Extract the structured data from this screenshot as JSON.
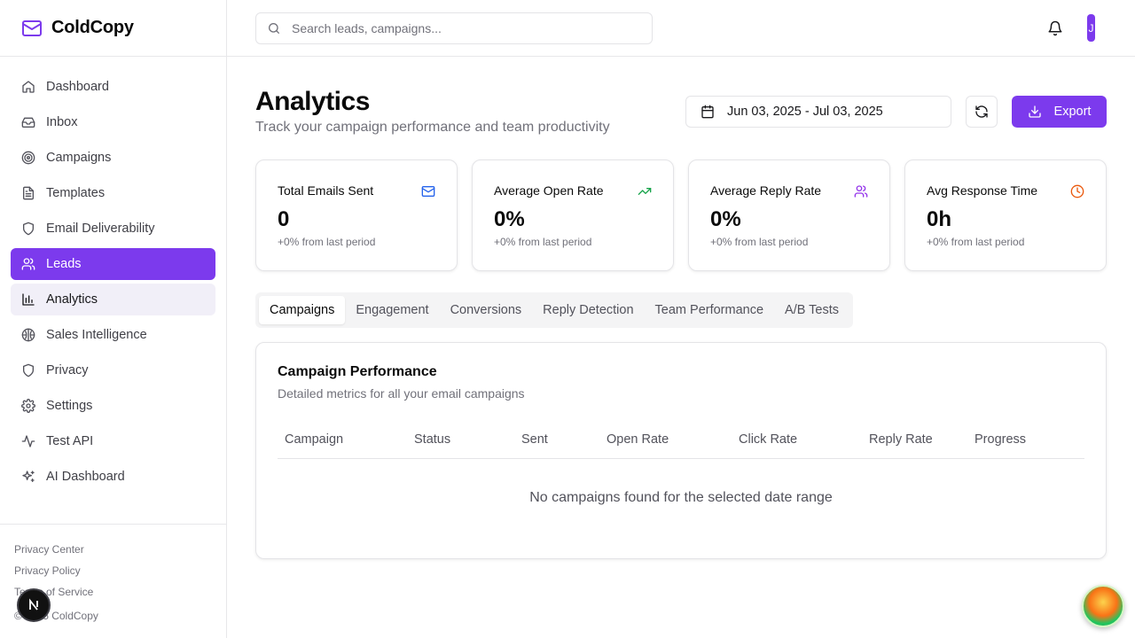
{
  "brand": {
    "name": "ColdCopy"
  },
  "search": {
    "placeholder": "Search leads, campaigns..."
  },
  "nav": {
    "items": [
      {
        "label": "Dashboard"
      },
      {
        "label": "Inbox"
      },
      {
        "label": "Campaigns"
      },
      {
        "label": "Templates"
      },
      {
        "label": "Email Deliverability"
      },
      {
        "label": "Leads"
      },
      {
        "label": "Analytics"
      },
      {
        "label": "Sales Intelligence"
      },
      {
        "label": "Privacy"
      },
      {
        "label": "Settings"
      },
      {
        "label": "Test API"
      },
      {
        "label": "AI Dashboard"
      }
    ]
  },
  "footer": {
    "links": [
      "Privacy Center",
      "Privacy Policy",
      "Terms of Service"
    ],
    "copyright": "© 2025 ColdCopy"
  },
  "user": {
    "initial": "J"
  },
  "page": {
    "title": "Analytics",
    "subtitle": "Track your campaign performance and team productivity",
    "date_range": "Jun 03, 2025 - Jul 03, 2025",
    "export_label": "Export"
  },
  "stats": [
    {
      "title": "Total Emails Sent",
      "value": "0",
      "change": "+0% from last period",
      "icon": "mail-icon",
      "color": "#2563eb"
    },
    {
      "title": "Average Open Rate",
      "value": "0%",
      "change": "+0% from last period",
      "icon": "trending-up-icon",
      "color": "#16a34a"
    },
    {
      "title": "Average Reply Rate",
      "value": "0%",
      "change": "+0% from last period",
      "icon": "users-icon",
      "color": "#9333ea"
    },
    {
      "title": "Avg Response Time",
      "value": "0h",
      "change": "+0% from last period",
      "icon": "clock-icon",
      "color": "#ea580c"
    }
  ],
  "tabs": [
    "Campaigns",
    "Engagement",
    "Conversions",
    "Reply Detection",
    "Team Performance",
    "A/B Tests"
  ],
  "panel": {
    "title": "Campaign Performance",
    "description": "Detailed metrics for all your email campaigns",
    "columns": [
      "Campaign",
      "Status",
      "Sent",
      "Open Rate",
      "Click Rate",
      "Reply Rate",
      "Progress"
    ],
    "empty_message": "No campaigns found for the selected date range"
  },
  "colors": {
    "accent": "#7c3aed"
  }
}
